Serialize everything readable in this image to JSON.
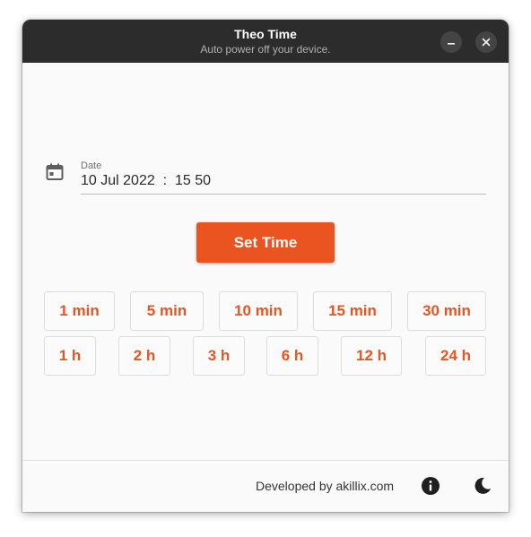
{
  "window": {
    "title": "Theo Time",
    "subtitle": "Auto power off your device.",
    "minimize_icon": "minimize-icon",
    "close_icon": "close-icon"
  },
  "date_field": {
    "icon": "calendar-icon",
    "label": "Date",
    "value": "10 Jul 2022  :  15 50"
  },
  "set_time_label": "Set Time",
  "presets": {
    "row1": [
      "1 min",
      "5 min",
      "10 min",
      "15 min",
      "30 min"
    ],
    "row2": [
      "1 h",
      "2 h",
      "3 h",
      "6 h",
      "12 h",
      "24 h"
    ]
  },
  "footer": {
    "developer_text": "Developed by akillix.com",
    "info_icon": "info-icon",
    "theme_icon": "dark-mode-icon"
  },
  "colors": {
    "accent": "#E95420",
    "titlebar": "#2C2C2C",
    "background": "#FAFAFA"
  }
}
